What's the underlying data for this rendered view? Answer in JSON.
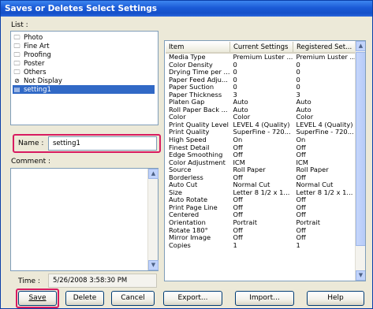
{
  "window": {
    "title": "Saves or Deletes Select Settings"
  },
  "list": {
    "label": "List :",
    "items": [
      {
        "label": "Photo",
        "icon": "folder-icon",
        "selected": false
      },
      {
        "label": "Fine Art",
        "icon": "folder-icon",
        "selected": false
      },
      {
        "label": "Proofing",
        "icon": "folder-icon",
        "selected": false
      },
      {
        "label": "Poster",
        "icon": "folder-icon",
        "selected": false
      },
      {
        "label": "Others",
        "icon": "folder-icon",
        "selected": false
      },
      {
        "label": "Not Display",
        "icon": "not-display-icon",
        "selected": false
      },
      {
        "label": "setting1",
        "icon": "document-icon",
        "selected": true
      }
    ]
  },
  "name": {
    "label": "Name :",
    "value": "setting1"
  },
  "comment": {
    "label": "Comment :",
    "value": ""
  },
  "time": {
    "label": "Time :",
    "value": "5/26/2008 3:58:30 PM"
  },
  "table": {
    "headers": [
      "Item",
      "Current Settings",
      "Registered Set..."
    ],
    "rows": [
      [
        "Media Type",
        "Premium Luster ...",
        "Premium Luster ..."
      ],
      [
        "Color Density",
        "0",
        "0"
      ],
      [
        "Drying Time per ...",
        "0",
        "0"
      ],
      [
        "Paper Feed Adju...",
        "0",
        "0"
      ],
      [
        "Paper Suction",
        "0",
        "0"
      ],
      [
        "Paper Thickness",
        "3",
        "3"
      ],
      [
        "Platen Gap",
        "Auto",
        "Auto"
      ],
      [
        "Roll Paper Back ...",
        "Auto",
        "Auto"
      ],
      [
        "Color",
        "Color",
        "Color"
      ],
      [
        "Print Quality Level",
        "LEVEL 4 (Quality)",
        "LEVEL 4 (Quality)"
      ],
      [
        "Print Quality",
        "SuperFine - 720...",
        "SuperFine - 720..."
      ],
      [
        "High Speed",
        "On",
        "On"
      ],
      [
        "Finest Detail",
        "Off",
        "Off"
      ],
      [
        "Edge Smoothing",
        "Off",
        "Off"
      ],
      [
        "Color Adjustment",
        "ICM",
        "ICM"
      ],
      [
        "Source",
        "Roll Paper",
        "Roll Paper"
      ],
      [
        "Borderless",
        "Off",
        "Off"
      ],
      [
        "Auto Cut",
        "Normal Cut",
        "Normal Cut"
      ],
      [
        "Size",
        "Letter 8 1/2 x 1...",
        "Letter 8 1/2 x 1..."
      ],
      [
        "Auto Rotate",
        "Off",
        "Off"
      ],
      [
        "Print Page Line",
        "Off",
        "Off"
      ],
      [
        "Centered",
        "Off",
        "Off"
      ],
      [
        "Orientation",
        "Portrait",
        "Portrait"
      ],
      [
        "Rotate 180°",
        "Off",
        "Off"
      ],
      [
        "Mirror Image",
        "Off",
        "Off"
      ],
      [
        "Copies",
        "1",
        "1"
      ]
    ]
  },
  "buttons": {
    "save": "Save",
    "delete": "Delete",
    "cancel": "Cancel",
    "export": "Export...",
    "import": "Import...",
    "help": "Help"
  },
  "colors": {
    "highlight": "#d81b60",
    "selection": "#3169c6",
    "titlebar": "#1a5ad6"
  }
}
